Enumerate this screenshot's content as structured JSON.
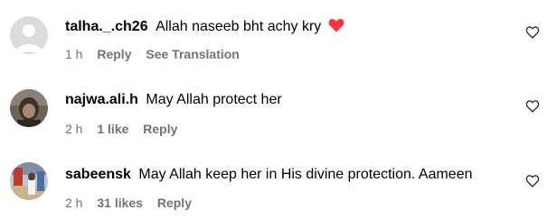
{
  "comments": [
    {
      "username": "talha._.ch26",
      "text": "Allah naseeb bht achy kry",
      "emoji": "red-heart-icon",
      "time": "1 h",
      "likes": "",
      "reply": "Reply",
      "translation": "See Translation",
      "avatar": "default-avatar"
    },
    {
      "username": "najwa.ali.h",
      "text": "May Allah protect her",
      "time": "2 h",
      "likes": "1 like",
      "reply": "Reply",
      "avatar": "photo-avatar"
    },
    {
      "username": "sabeensk",
      "text": "May Allah keep her in His divine protection. Aameen",
      "time": "2 h",
      "likes": "31 likes",
      "reply": "Reply",
      "avatar": "photo-avatar"
    }
  ],
  "colors": {
    "meta_text": "#737373",
    "heart": "#ff3040",
    "default_avatar_bg": "#dbdbdb"
  }
}
